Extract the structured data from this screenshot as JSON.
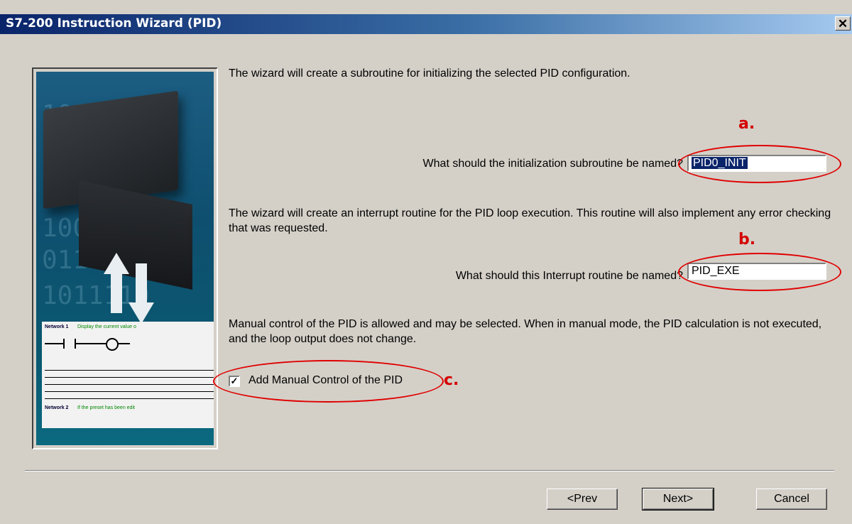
{
  "window": {
    "title": "S7-200 Instruction Wizard (PID)",
    "close_label": "✕"
  },
  "image_panel": {
    "binary_rows": [
      "1001101",
      "1001101",
      "0111010",
      "1011110"
    ],
    "ladder": {
      "network1": "Network 1",
      "network1_desc": "Display the current value o",
      "network2": "Network 2",
      "network2_desc": "If the preset has been edit"
    }
  },
  "intro_text": "The wizard will create a subroutine for initializing the selected PID configuration.",
  "init_subroutine": {
    "label": "What should the initialization subroutine be named?",
    "value": "PID0_INIT"
  },
  "interrupt_text": "The wizard will create an interrupt routine for the PID loop execution.  This routine will also implement any error checking that was requested.",
  "interrupt_routine": {
    "label": "What should this Interrupt routine be named?",
    "value": "PID_EXE"
  },
  "manual_text": "Manual control of the PID is allowed and may be selected.  When in manual mode, the PID calculation is not executed, and the loop output does not change.",
  "manual_checkbox": {
    "label": "Add Manual Control of the PID",
    "checked": true,
    "check_glyph": "✓"
  },
  "annotations": {
    "a": "a.",
    "b": "b.",
    "c": "c.",
    "color": "#e00000"
  },
  "buttons": {
    "prev": "<Prev",
    "next": "Next>",
    "cancel": "Cancel"
  }
}
